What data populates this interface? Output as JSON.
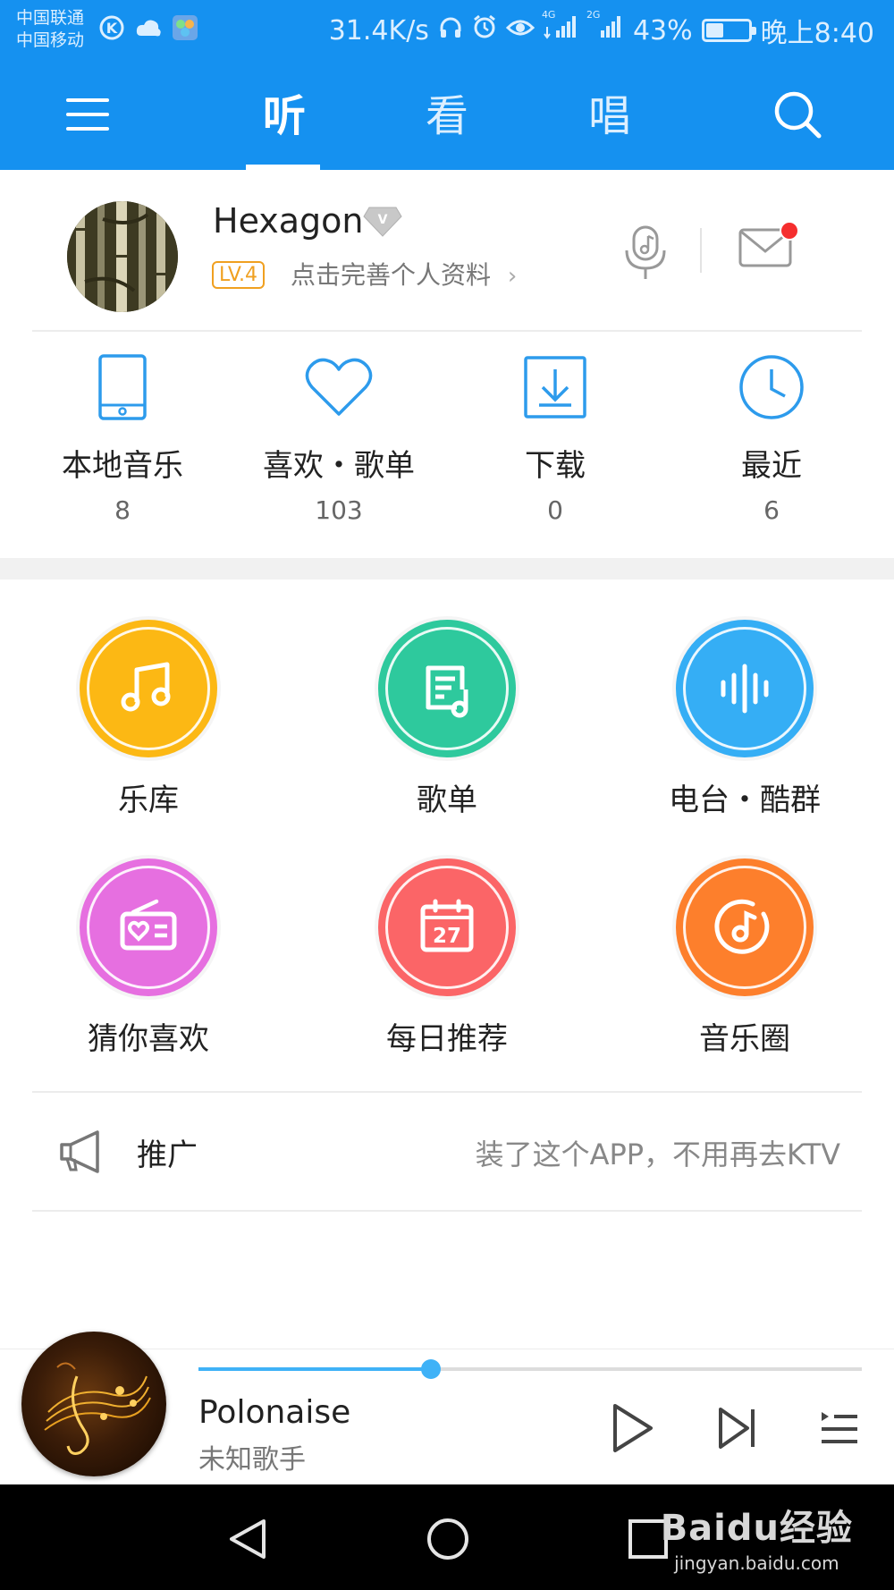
{
  "status_bar": {
    "carrier_1": "中国联通",
    "carrier_2": "中国移动",
    "speed": "31.4K/s",
    "network_1": "4G",
    "network_2": "2G",
    "battery": "43%",
    "battery_level": 0.43,
    "time": "晚上8:40"
  },
  "nav": {
    "tabs": [
      {
        "label": "听",
        "active": true
      },
      {
        "label": "看",
        "active": false
      },
      {
        "label": "唱",
        "active": false
      }
    ],
    "accent_color": "#1591f0"
  },
  "profile": {
    "username": "Hexagon",
    "level": "LV.4",
    "hint": "点击完善个人资料",
    "has_new_message": true
  },
  "stats": [
    {
      "label": "本地音乐",
      "count": "8",
      "icon": "tablet-icon"
    },
    {
      "label": "喜欢・歌单",
      "count": "103",
      "icon": "heart-icon"
    },
    {
      "label": "下载",
      "count": "0",
      "icon": "download-icon"
    },
    {
      "label": "最近",
      "count": "6",
      "icon": "clock-icon"
    }
  ],
  "features": [
    {
      "label": "乐库",
      "icon": "music-note-icon",
      "color": "#fcb814"
    },
    {
      "label": "歌单",
      "icon": "playlist-icon",
      "color": "#2ec99d"
    },
    {
      "label": "电台・酷群",
      "icon": "soundwave-icon",
      "color": "#35aef5"
    },
    {
      "label": "猜你喜欢",
      "icon": "radio-heart-icon",
      "color": "#e66fe0"
    },
    {
      "label": "每日推荐",
      "icon": "calendar-icon",
      "calendar_day": "27",
      "color": "#fb6567"
    },
    {
      "label": "音乐圈",
      "icon": "music-disc-icon",
      "color": "#fd7f2c"
    }
  ],
  "promo": {
    "title": "推广",
    "text": "装了这个APP，不用再去KTV"
  },
  "player": {
    "title": "Polonaise",
    "artist": "未知歌手",
    "progress": 0.35
  },
  "watermark": {
    "main": "Baidu经验",
    "sub": "jingyan.baidu.com"
  }
}
